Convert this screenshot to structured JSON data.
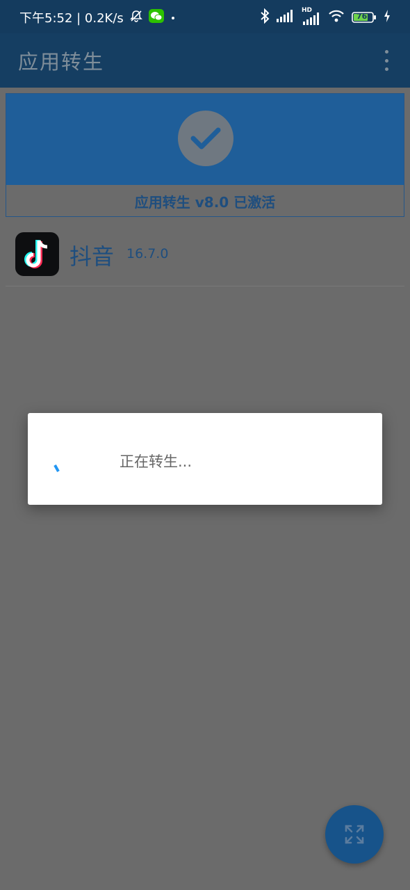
{
  "status_bar": {
    "time_speed": "下午5:52 | 0.2K/s",
    "hd_label": "HD",
    "battery": "76",
    "icons": [
      "bell-off-icon",
      "wechat-icon",
      "dot-icon",
      "bluetooth-icon",
      "signal-icon",
      "hd-signal-icon",
      "wifi-icon",
      "battery-icon",
      "charging-icon"
    ]
  },
  "app_bar": {
    "title": "应用转生",
    "menu_icon": "more-vert-icon"
  },
  "status_card": {
    "text": "应用转生 v8.0 已激活",
    "icon": "check-icon"
  },
  "app_list": [
    {
      "name": "抖音",
      "version": "16.7.0",
      "icon": "tiktok-icon"
    }
  ],
  "dialog": {
    "message": "正在转生..."
  },
  "fab": {
    "icon": "expand-arrows-icon"
  },
  "colors": {
    "accent": "#1f5e99",
    "appbar": "#153e62",
    "overlay": "#6b6b6b",
    "spinner": "#2196f3"
  }
}
